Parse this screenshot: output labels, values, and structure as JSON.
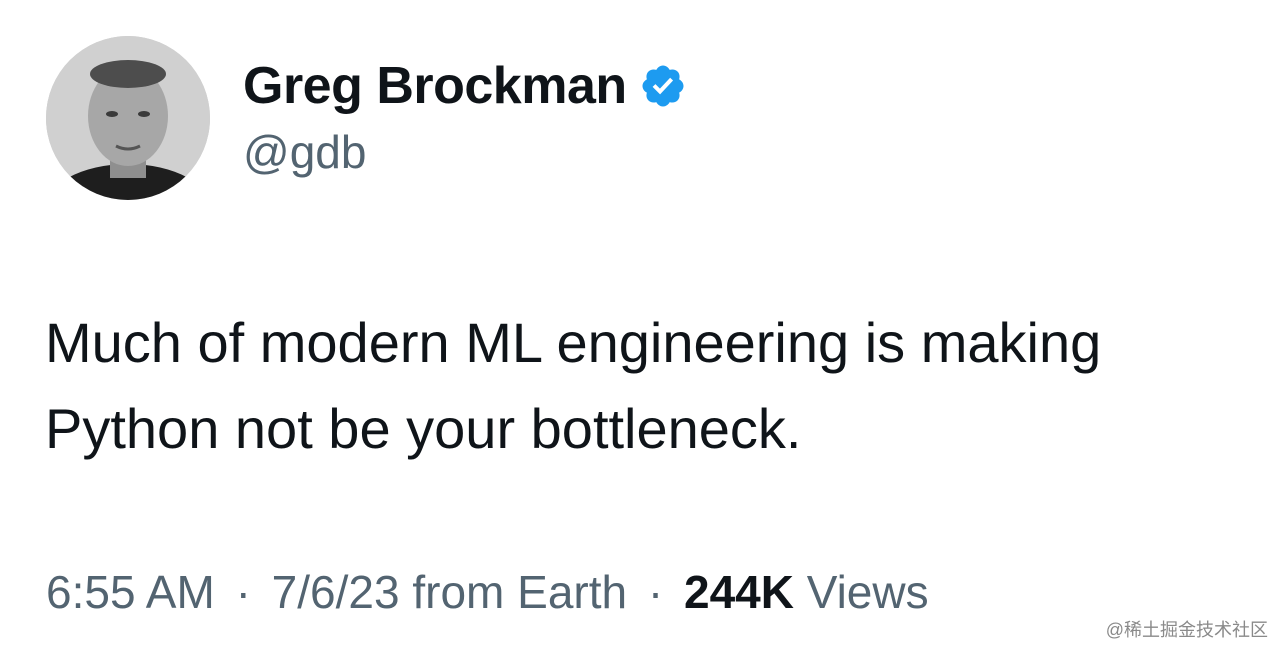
{
  "author": {
    "display_name": "Greg Brockman",
    "handle": "@gdb",
    "verified": true,
    "verified_icon": "verified-badge-icon",
    "badge_color": "#1d9bf0"
  },
  "tweet": {
    "text_lines": [
      "Much of modern ML engineering is making",
      "Python not be your bottleneck."
    ]
  },
  "meta": {
    "time": "6:55 AM",
    "separator": "·",
    "date": "7/6/23",
    "source": "from Earth",
    "views_count": "244K",
    "views_label": "Views"
  },
  "watermark": "@稀土掘金技术社区"
}
